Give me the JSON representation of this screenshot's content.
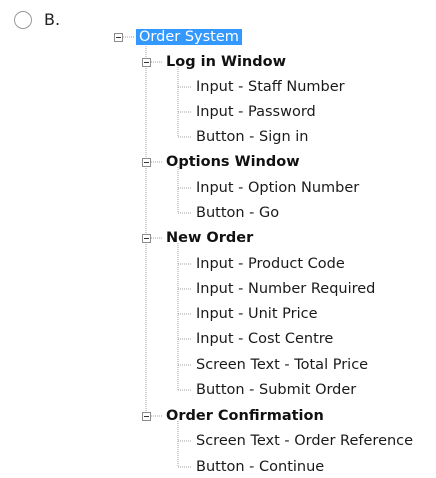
{
  "option": {
    "letter": "B."
  },
  "tree": {
    "root": "Order System",
    "groups": [
      {
        "label": "Log in Window",
        "items": [
          "Input - Staff Number",
          "Input - Password",
          "Button - Sign in"
        ]
      },
      {
        "label": "Options Window",
        "items": [
          "Input - Option Number",
          "Button - Go"
        ]
      },
      {
        "label": "New Order",
        "items": [
          "Input - Product Code",
          "Input - Number Required",
          "Input - Unit Price",
          "Input - Cost Centre",
          "Screen Text - Total Price",
          "Button - Submit Order"
        ]
      },
      {
        "label": "Order Confirmation",
        "items": [
          "Screen Text - Order Reference",
          "Button - Continue"
        ]
      }
    ]
  },
  "colors": {
    "selection": "#3399ff",
    "tree_line": "#a0a0a0"
  }
}
